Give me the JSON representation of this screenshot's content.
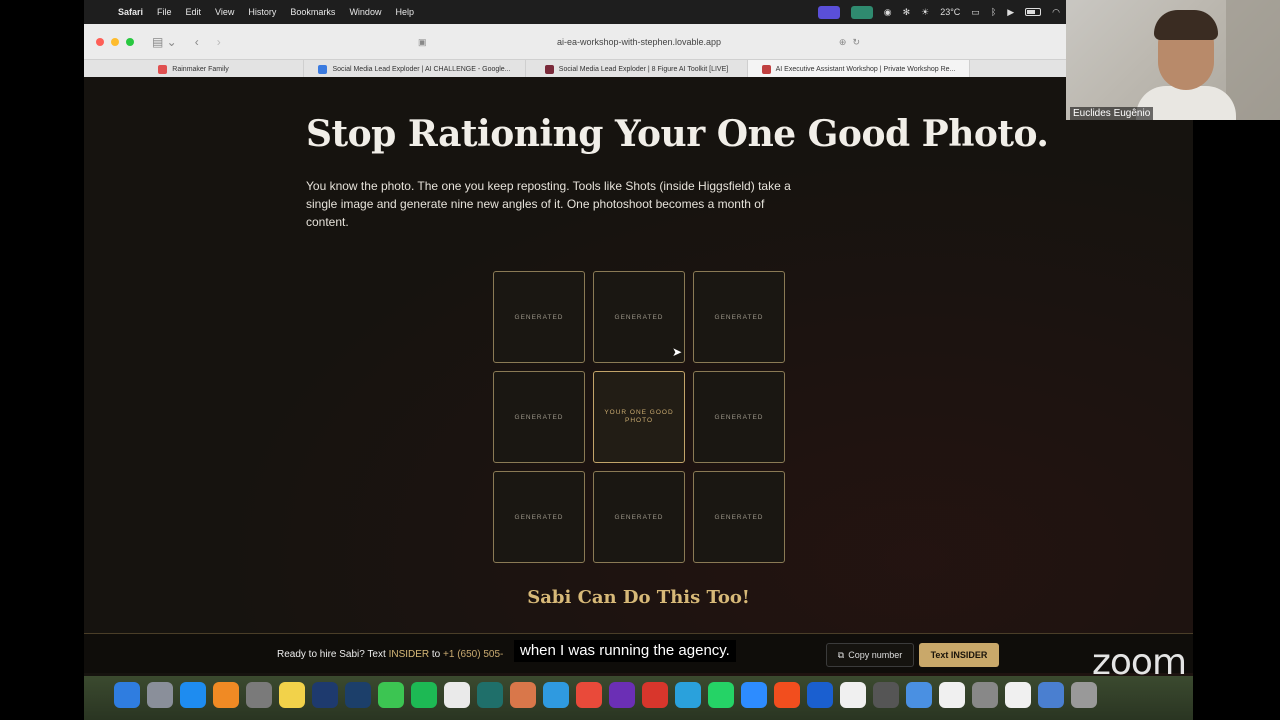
{
  "menubar": {
    "app_name": "Safari",
    "menus": [
      "File",
      "Edit",
      "View",
      "History",
      "Bookmarks",
      "Window",
      "Help"
    ],
    "temperature": "23°C"
  },
  "browser": {
    "url": "ai-ea-workshop-with-stephen.lovable.app",
    "tabs": [
      {
        "label": "Rainmaker Family",
        "color": "#e05050"
      },
      {
        "label": "Social Media Lead Exploder | AI CHALLENGE - Google...",
        "color": "#3b7be0"
      },
      {
        "label": "Social Media Lead Exploder | 8 Figure AI Toolkit [LIVE]",
        "color": "#7a2a3a"
      },
      {
        "label": "AI Executive Assistant Workshop | Private Workshop Re...",
        "color": "#c04040"
      }
    ]
  },
  "page": {
    "headline": "Stop Rationing Your One Good Photo.",
    "description": "You know the photo. The one you keep reposting. Tools like Shots (inside Higgsfield) take a single image and generate nine new angles of it. One photoshoot becomes a month of content.",
    "grid_cells": [
      "GENERATED",
      "GENERATED",
      "GENERATED",
      "GENERATED",
      "YOUR ONE GOOD PHOTO",
      "GENERATED",
      "GENERATED",
      "GENERATED",
      "GENERATED"
    ],
    "sabi_heading": "Sabi Can Do This Too!"
  },
  "cta": {
    "prefix": "Ready to hire Sabi? Text ",
    "keyword": "INSIDER",
    "middle": " to ",
    "phone": "+1 (650) 505-",
    "copy_label": "Copy number",
    "text_label": "Text INSIDER"
  },
  "caption": "when I was running the agency.",
  "webcam": {
    "participant_name": "Euclides Eugênio"
  },
  "zoom_logo": "zoom",
  "dock": {
    "apps": [
      "finder",
      "launchpad",
      "app-store",
      "books",
      "system-settings",
      "notes",
      "photoshop",
      "lightroom-classic",
      "messages",
      "spotify",
      "chatgpt",
      "perplexity",
      "claude",
      "safari",
      "chrome",
      "slack",
      "creative-cloud",
      "telegram",
      "whatsapp",
      "zoom",
      "figma",
      "1password",
      "calendar",
      "calculator",
      "preview",
      "reminders",
      "screenshot",
      "textedit",
      "downloads",
      "trash"
    ]
  }
}
